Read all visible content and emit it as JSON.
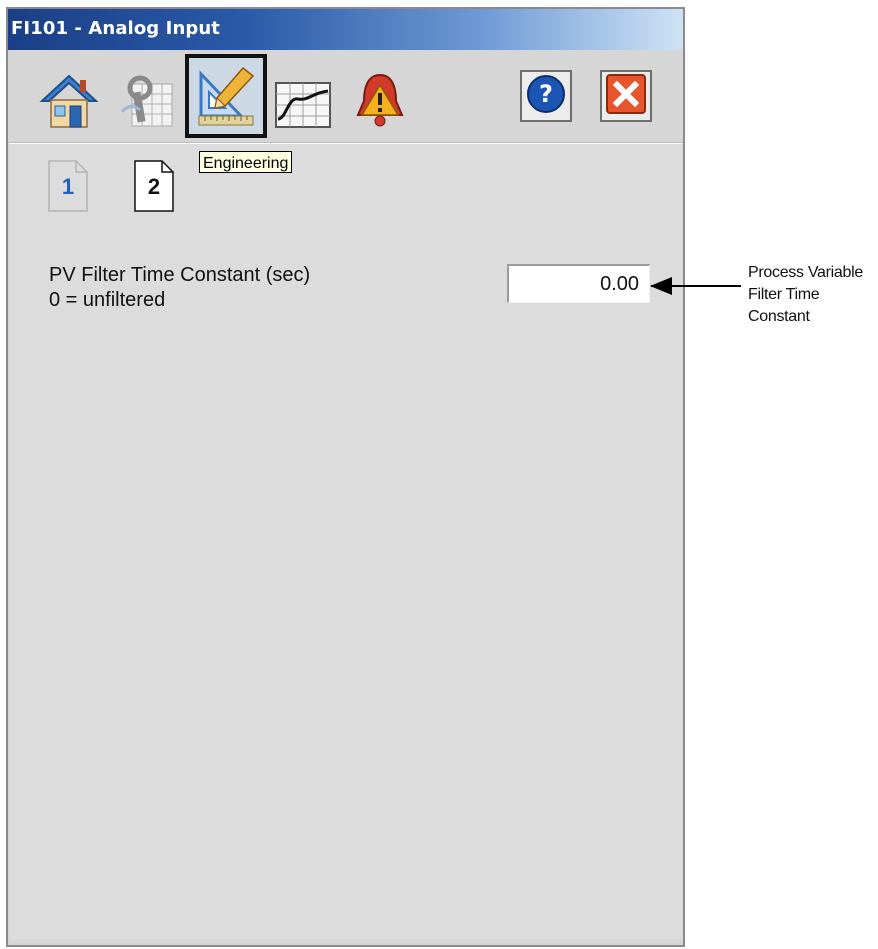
{
  "window": {
    "title": "FI101 - Analog Input"
  },
  "toolbar": {
    "buttons": [
      {
        "icon": "home-icon"
      },
      {
        "icon": "maintenance-icon"
      },
      {
        "icon": "engineering-icon",
        "selected": true
      },
      {
        "icon": "trend-icon"
      },
      {
        "icon": "alarm-bell-icon"
      },
      {
        "icon": "help-icon"
      },
      {
        "icon": "close-icon"
      }
    ],
    "tooltip": "Engineering"
  },
  "pages": [
    {
      "label": "1",
      "active": false
    },
    {
      "label": "2",
      "active": true
    }
  ],
  "parameters": {
    "pv_filter_label": "PV Filter Time Constant (sec)",
    "pv_filter_note": "0 = unfiltered",
    "pv_filter_value": "0.00"
  },
  "callout": {
    "line1": "Process Variable",
    "line2": "Filter Time",
    "line3": "Constant"
  },
  "colors": {
    "titlebar_dark": "#1b3f86",
    "titlebar_light": "#cfe2f5",
    "panel_background": "#dcdcdc",
    "page1_number": "#1f5fbf",
    "close_button": "#e8542c",
    "help_button": "#1c56b4"
  }
}
